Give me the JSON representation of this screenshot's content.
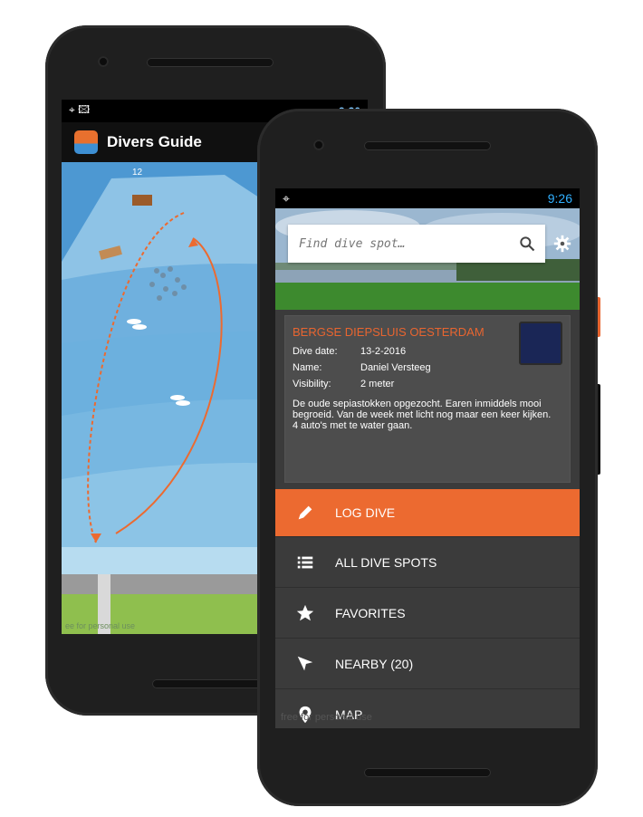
{
  "back_phone": {
    "status": {
      "left": "⌖ 🖾",
      "right": "9:30"
    },
    "app_title": "Divers Guide",
    "map": {
      "depth_label": "12",
      "footer_note": "ee for personal use"
    }
  },
  "front_phone": {
    "status": {
      "left": "⌖",
      "time": "9:26"
    },
    "search": {
      "placeholder": "Find dive spot…"
    },
    "dive_card": {
      "title": "BERGSE DIEPSLUIS OESTERDAM",
      "fields": [
        {
          "label": "Dive date:",
          "value": "13-2-2016"
        },
        {
          "label": "Name:",
          "value": "Daniel Versteeg"
        },
        {
          "label": "Visibility:",
          "value": "2 meter"
        }
      ],
      "description": "De oude sepiastokken opgezocht. Earen inmiddels mooi begroeid. Van de week met licht nog maar een keer kijken. 4 auto's met te water gaan."
    },
    "menu": [
      {
        "label": "LOG DIVE",
        "icon": "pencil-icon"
      },
      {
        "label": "ALL DIVE SPOTS",
        "icon": "list-icon"
      },
      {
        "label": "FAVORITES",
        "icon": "star-icon"
      },
      {
        "label": "NEARBY (20)",
        "icon": "nearby-arrow-icon"
      },
      {
        "label": "MAP",
        "icon": "map-pin-icon"
      }
    ],
    "footer_note": "free for personal use"
  },
  "colors": {
    "accent": "#ec6a30",
    "panel": "#3b3b3b",
    "card": "#4d4d4d",
    "water": "#62a5d6"
  }
}
